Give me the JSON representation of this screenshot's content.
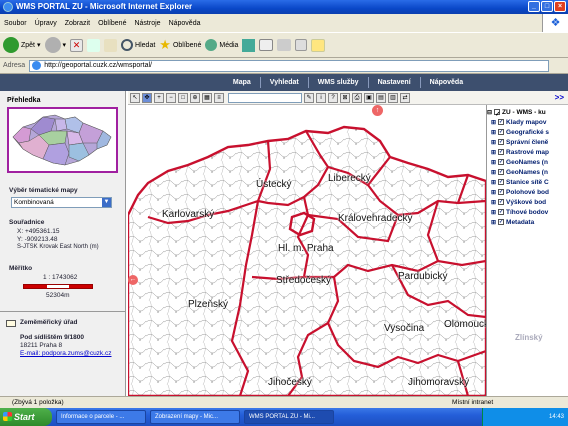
{
  "window": {
    "title": "WMS PORTAL ZU - Microsoft Internet Explorer"
  },
  "menu": [
    "Soubor",
    "Úpravy",
    "Zobrazit",
    "Oblíbené",
    "Nástroje",
    "Nápověda"
  ],
  "toolbar": {
    "back": "Zpět",
    "search": "Hledat",
    "favorites": "Oblíbené",
    "media": "Média"
  },
  "address": {
    "label": "Adresa",
    "url": "http://geoportal.cuzk.cz/wmsportal/"
  },
  "nav": [
    "Mapa",
    "Vyhledat",
    "WMS služby",
    "Nastavení",
    "Nápověda"
  ],
  "left": {
    "overview_title": "Přehledka",
    "theme_title": "Výběr tématické mapy",
    "theme_value": "Kombinovaná",
    "coords_title": "Souřadnice",
    "x": "X: +495361.15",
    "y": "Y: -909213.48",
    "crs": "S-JTSK Krovak East North (m)",
    "scale_title": "Měřítko",
    "scale_ratio": "1 : 1743062",
    "scale_len": "52304m",
    "office_title": "Zeměměřický úřad",
    "addr1": "Pod sídlištěm 9/1800",
    "addr2": "18211 Praha 8",
    "email": "E-mail: podpora.zums@cuzk.cz"
  },
  "map": {
    "regions": [
      "Ústecký",
      "Liberecký",
      "Karlovarský",
      "Královehradecký",
      "Hl. m. Praha",
      "Středočeský",
      "Pardubický",
      "Plzeňský",
      "Vysočina",
      "Olomoucký",
      "Jihočeský",
      "Jihomoravský"
    ]
  },
  "layers": {
    "root": "ZU - WMS - ku",
    "items": [
      "Klady mapov",
      "Geografické s",
      "Správní členě",
      "Rastrové map",
      "GeoNames (n",
      "GeoNames (n",
      "Stanice sítě C",
      "Polohové bod",
      "Výškové bod",
      "Tíhové bodov",
      "Metadata"
    ],
    "faded": [
      "Zlínský"
    ]
  },
  "status": {
    "left": "(Zbývá 1 položka)",
    "zone": "Místní intranet"
  },
  "taskbar": {
    "start": "Start",
    "tasks": [
      "Informace o parcele - ...",
      "Zobrazení mapy - Mic...",
      "WMS PORTAL ZU - Mi..."
    ],
    "time": "14:43"
  },
  "colors": {
    "boundary": "#c8102e",
    "nav": "#3d4f6e",
    "overview_border": "#a020a0"
  }
}
